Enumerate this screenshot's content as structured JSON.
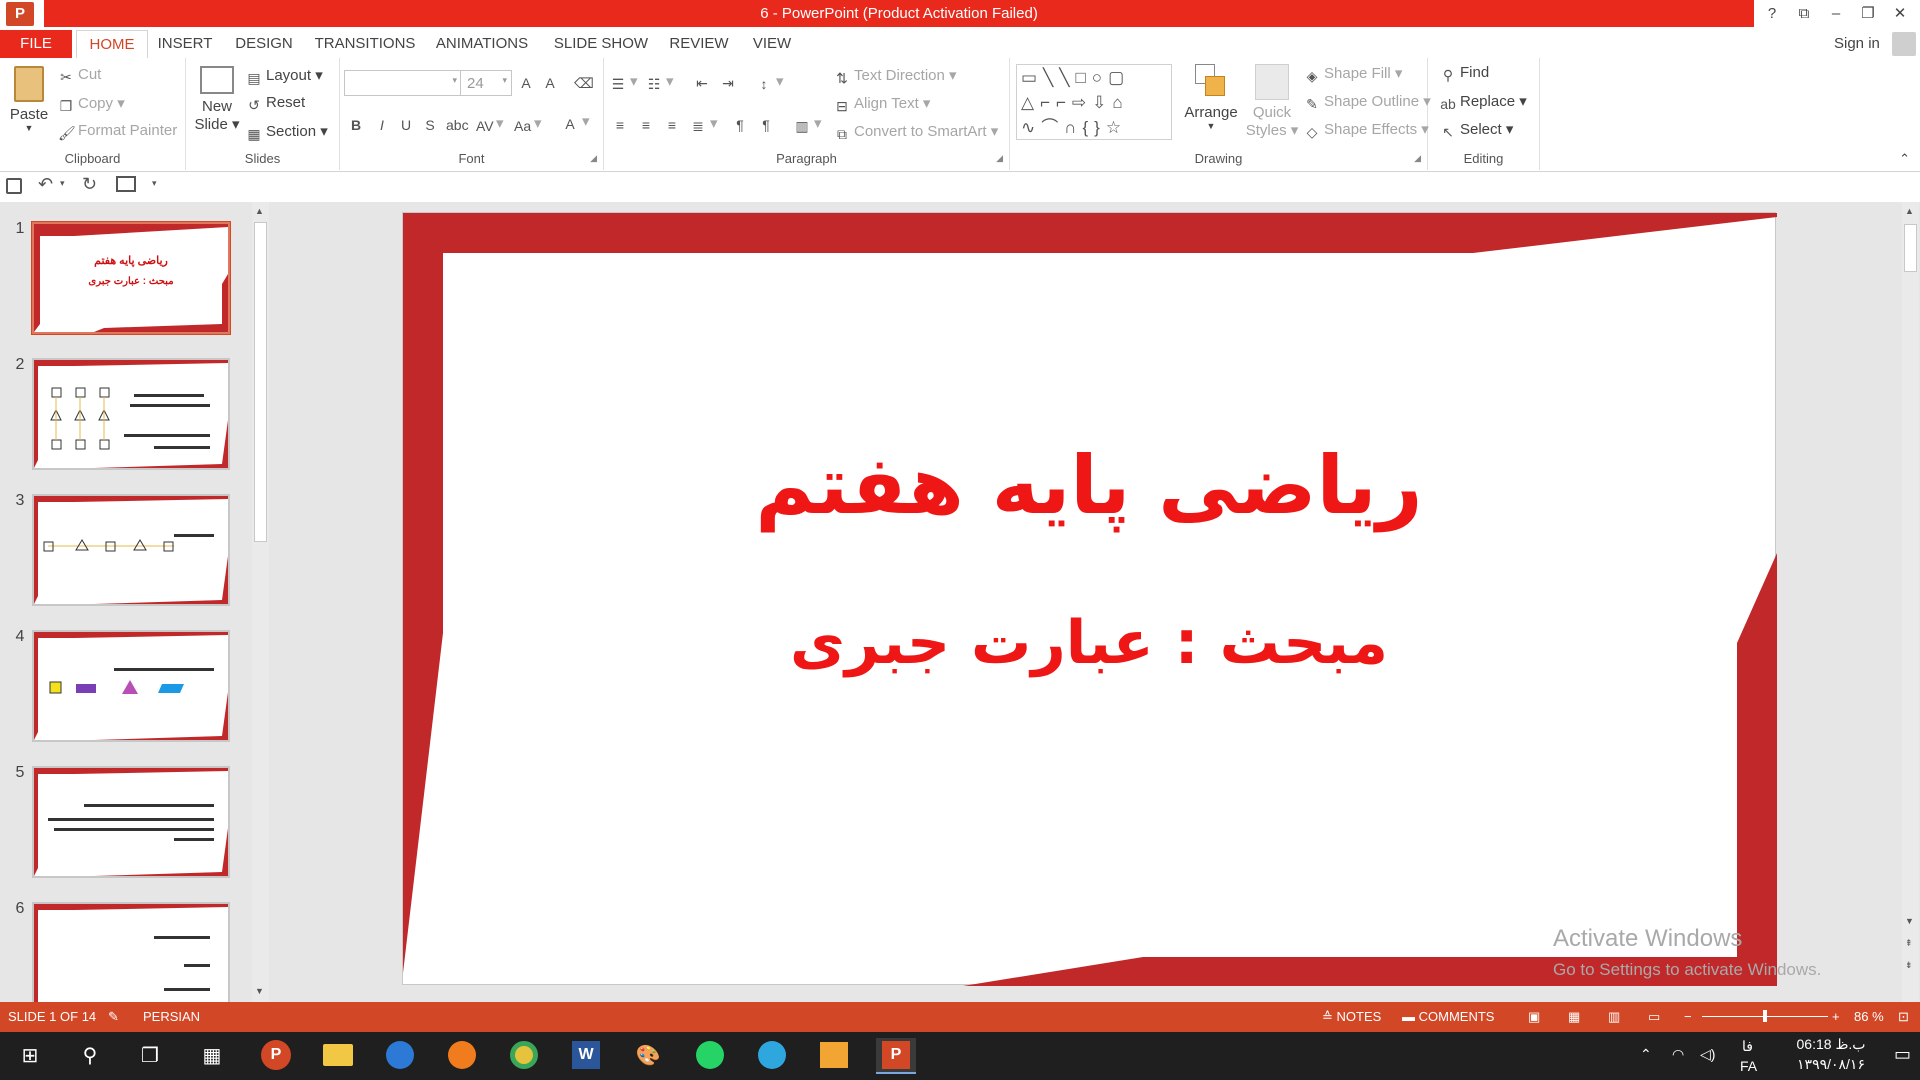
{
  "window": {
    "title": "6 -  PowerPoint (Product Activation Failed)",
    "controls": [
      "?",
      "⧉",
      "–",
      "❐",
      "✕"
    ]
  },
  "tabs": [
    "FILE",
    "HOME",
    "INSERT",
    "DESIGN",
    "TRANSITIONS",
    "ANIMATIONS",
    "SLIDE SHOW",
    "REVIEW",
    "VIEW"
  ],
  "active_tab": "HOME",
  "account": {
    "sign_in": "Sign in"
  },
  "ribbon": {
    "clipboard": {
      "paste": "Paste",
      "cut": "Cut",
      "copy": "Copy",
      "format_painter": "Format Painter",
      "label": "Clipboard"
    },
    "slides": {
      "new_slide_1": "New",
      "new_slide_2": "Slide",
      "layout": "Layout",
      "reset": "Reset",
      "section": "Section",
      "label": "Slides"
    },
    "font": {
      "font_name": "",
      "font_size": "24",
      "label": "Font"
    },
    "paragraph": {
      "text_direction": "Text Direction",
      "align_text": "Align Text",
      "convert_smartart": "Convert to SmartArt",
      "label": "Paragraph"
    },
    "drawing": {
      "arrange": "Arrange",
      "quick_styles_1": "Quick",
      "quick_styles_2": "Styles",
      "shape_fill": "Shape Fill",
      "shape_outline": "Shape Outline",
      "shape_effects": "Shape Effects",
      "label": "Drawing"
    },
    "editing": {
      "find": "Find",
      "replace": "Replace",
      "select": "Select",
      "label": "Editing"
    }
  },
  "thumbnails": [
    {
      "num": "1",
      "title": "ریاضی پایه هفتم",
      "subtitle": "مبحث : عبارت جبری"
    },
    {
      "num": "2"
    },
    {
      "num": "3"
    },
    {
      "num": "4"
    },
    {
      "num": "5"
    },
    {
      "num": "6"
    }
  ],
  "slide": {
    "title": "ریاضی پایه هفتم",
    "subtitle": "مبحث : عبارت جبری",
    "accent_color": "#c0282a",
    "text_color": "#ef1616"
  },
  "watermark": {
    "line1": "Activate Windows",
    "line2": "Go to Settings to activate Windows."
  },
  "status": {
    "slide_info": "SLIDE 1 OF 14",
    "language": "PERSIAN",
    "notes": "NOTES",
    "comments": "COMMENTS",
    "zoom": "86 %",
    "zoom_fraction": 0.5,
    "bar_color": "#d24726"
  },
  "taskbar": {
    "time": "06:18 ب.ظ",
    "date": "۱۳۹۹/۰۸/۱۶",
    "lang_1": "فا",
    "lang_2": "FA"
  }
}
